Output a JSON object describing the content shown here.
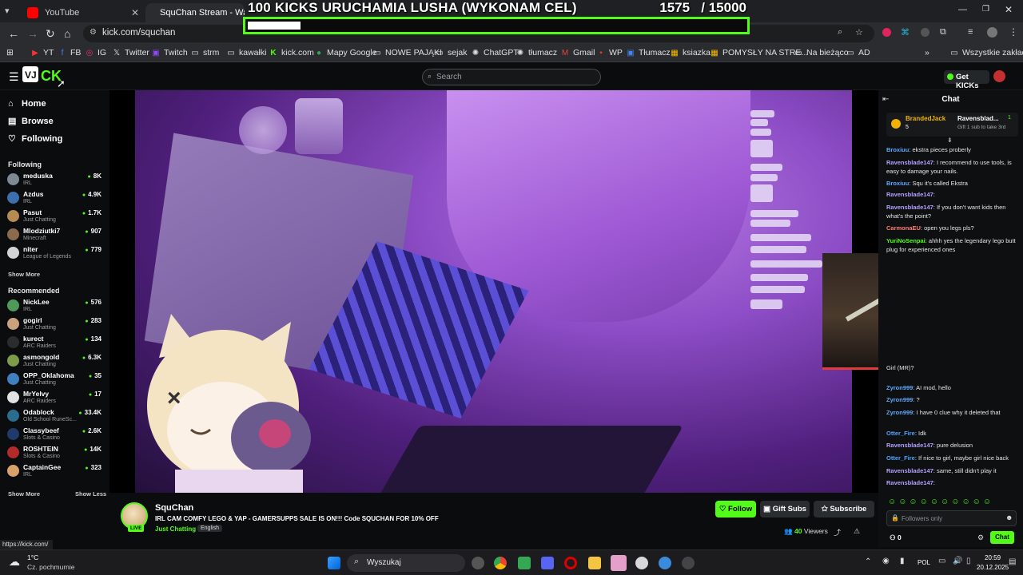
{
  "browser": {
    "tabs": [
      {
        "label": "YouTube"
      },
      {
        "label": "SquChan Stream - Watch Li"
      }
    ],
    "url": "kick.com/squchan",
    "bookmarks": [
      "YT",
      "FB",
      "IG",
      "Twitter",
      "Twitch",
      "strm",
      "kawałki",
      "kick.com",
      "Mapy Google",
      "NOWE PAJĄKI",
      "sejak",
      "ChatGPT",
      "tłumacz",
      "Gmail",
      "WP",
      "Tłumacz",
      "ksiazka",
      "POMYSŁY NA STRE...",
      "Na bieżąco",
      "AD"
    ],
    "all_bookmarks": "Wszystkie zakładki",
    "status_url": "https://kick.com/"
  },
  "overlay": {
    "title": "100 KICKS URUCHAMIA LUSHA (WYKONAM CEL)",
    "count": "1575",
    "goal": "/ 15000",
    "progress": 0.105
  },
  "kick": {
    "search_placeholder": "Search",
    "get_kicks": "Get KICKs",
    "nav": {
      "home": "Home",
      "browse": "Browse",
      "following": "Following"
    },
    "following_title": "Following",
    "following": [
      {
        "name": "meduska",
        "cat": "IRL",
        "count": "8K",
        "color": "#7d8a96"
      },
      {
        "name": "Azdus",
        "cat": "IRL",
        "count": "4.9K",
        "color": "#3b6fb0"
      },
      {
        "name": "Pasut",
        "cat": "Just Chatting",
        "count": "1.7K",
        "color": "#b58b52"
      },
      {
        "name": "Mlodziutki7",
        "cat": "Minecraft",
        "count": "907",
        "color": "#8c6a4e"
      },
      {
        "name": "niter",
        "cat": "League of Legends",
        "count": "779",
        "color": "#d4d4d4"
      }
    ],
    "show_more_1": "Show More",
    "recommended_title": "Recommended",
    "recommended": [
      {
        "name": "NickLee",
        "cat": "IRL",
        "count": "576",
        "color": "#4f9a5a"
      },
      {
        "name": "gogirl",
        "cat": "Just Chatting",
        "count": "283",
        "color": "#c9a27e"
      },
      {
        "name": "kurect",
        "cat": "ARC Raiders",
        "count": "134",
        "color": "#2c2c2c"
      },
      {
        "name": "asmongold",
        "cat": "Just Chatting",
        "count": "6.3K",
        "color": "#7c9c4a"
      },
      {
        "name": "OPP_Oklahoma",
        "cat": "Just Chatting",
        "count": "35",
        "color": "#3f7fbf"
      },
      {
        "name": "MrYelvy",
        "cat": "ARC Raiders",
        "count": "17",
        "color": "#e2e2e2"
      },
      {
        "name": "Odablock",
        "cat": "Old School RuneSc...",
        "count": "33.4K",
        "color": "#2a6d8f"
      },
      {
        "name": "Classybeef",
        "cat": "Slots & Casino",
        "count": "2.6K",
        "color": "#1f3a6b"
      },
      {
        "name": "ROSHTEIN",
        "cat": "Slots & Casino",
        "count": "14K",
        "color": "#b22a2a"
      },
      {
        "name": "CaptainGee",
        "cat": "IRL",
        "count": "323",
        "color": "#d9a26b"
      }
    ],
    "show_more_2": "Show More",
    "show_less": "Show Less"
  },
  "stream": {
    "streamer": "SquChan",
    "live": "LIVE",
    "title": "IRL CAM COMFY LEGO & YAP -  GAMERSUPPS SALE IS ON!!!  Code SQUCHAN FOR 10% OFF",
    "category": "Just Chatting",
    "language": "English",
    "follow": "Follow",
    "gift_subs": "Gift Subs",
    "subscribe": "Subscribe",
    "viewers_count": "40",
    "viewers_label": "Viewers"
  },
  "chat": {
    "title": "Chat",
    "pinned_user1": "BrandedJack",
    "pinned_user1_count": "5",
    "pinned_user2": "Ravensblad...",
    "pinned_user2_count": "1",
    "pinned_text": "Gift 1 sub to take 3rd",
    "messages": [
      {
        "user": "Broxiuu",
        "color": "#5fa8ff",
        "text": ": ekstra pieces proberly"
      },
      {
        "user": "Ravensblade147",
        "color": "#b4a0ff",
        "text": ": I recommend to use tools, is easy to damage your nails."
      },
      {
        "user": "Broxiuu",
        "color": "#5fa8ff",
        "text": ": Squ it's called Ekstra"
      },
      {
        "user": "Ravensblade147",
        "color": "#b4a0ff",
        "text": ":"
      },
      {
        "user": "Ravensblade147",
        "color": "#b4a0ff",
        "text": ": If you don't want kids then what's the point?"
      },
      {
        "user": "CarmonaEU",
        "color": "#ff7a7a",
        "text": ": open you legs pls?"
      },
      {
        "user": "YuriNoSenpai",
        "color": "#53fc18",
        "text": ": ahhh yes the legendary lego butt plug for experienced ones"
      },
      {
        "user": "",
        "color": "#e6e6e6",
        "text": "Girl (MR)?"
      },
      {
        "user": "Zyron999",
        "color": "#5fa8ff",
        "text": ": AI mod, hello"
      },
      {
        "user": "Zyron999",
        "color": "#5fa8ff",
        "text": ": ?"
      },
      {
        "user": "Zyron999",
        "color": "#5fa8ff",
        "text": ": I have 0 clue why it deleted that"
      },
      {
        "user": "Otter_Fire",
        "color": "#4fa3ff",
        "text": ": Idk"
      },
      {
        "user": "Ravensblade147",
        "color": "#b4a0ff",
        "text": ": pure delusion"
      },
      {
        "user": "Otter_Fire",
        "color": "#4fa3ff",
        "text": ": If nice to girl, maybe girl nice back"
      },
      {
        "user": "Ravensblade147",
        "color": "#b4a0ff",
        "text": ": same, still didn't play it"
      },
      {
        "user": "Ravensblade147",
        "color": "#b4a0ff",
        "text": ":"
      }
    ],
    "input_placeholder": "Followers only",
    "send": "Chat",
    "points": "0"
  },
  "taskbar": {
    "temp": "1°C",
    "weather": "Cz. pochmurnie",
    "search": "Wyszukaj",
    "lang": "POL",
    "time": "20:59",
    "date": "20.12.2025"
  },
  "colors": {
    "kick_green": "#53fc18",
    "bg": "#0b0c0d",
    "chrome": "#2b2c2f"
  }
}
